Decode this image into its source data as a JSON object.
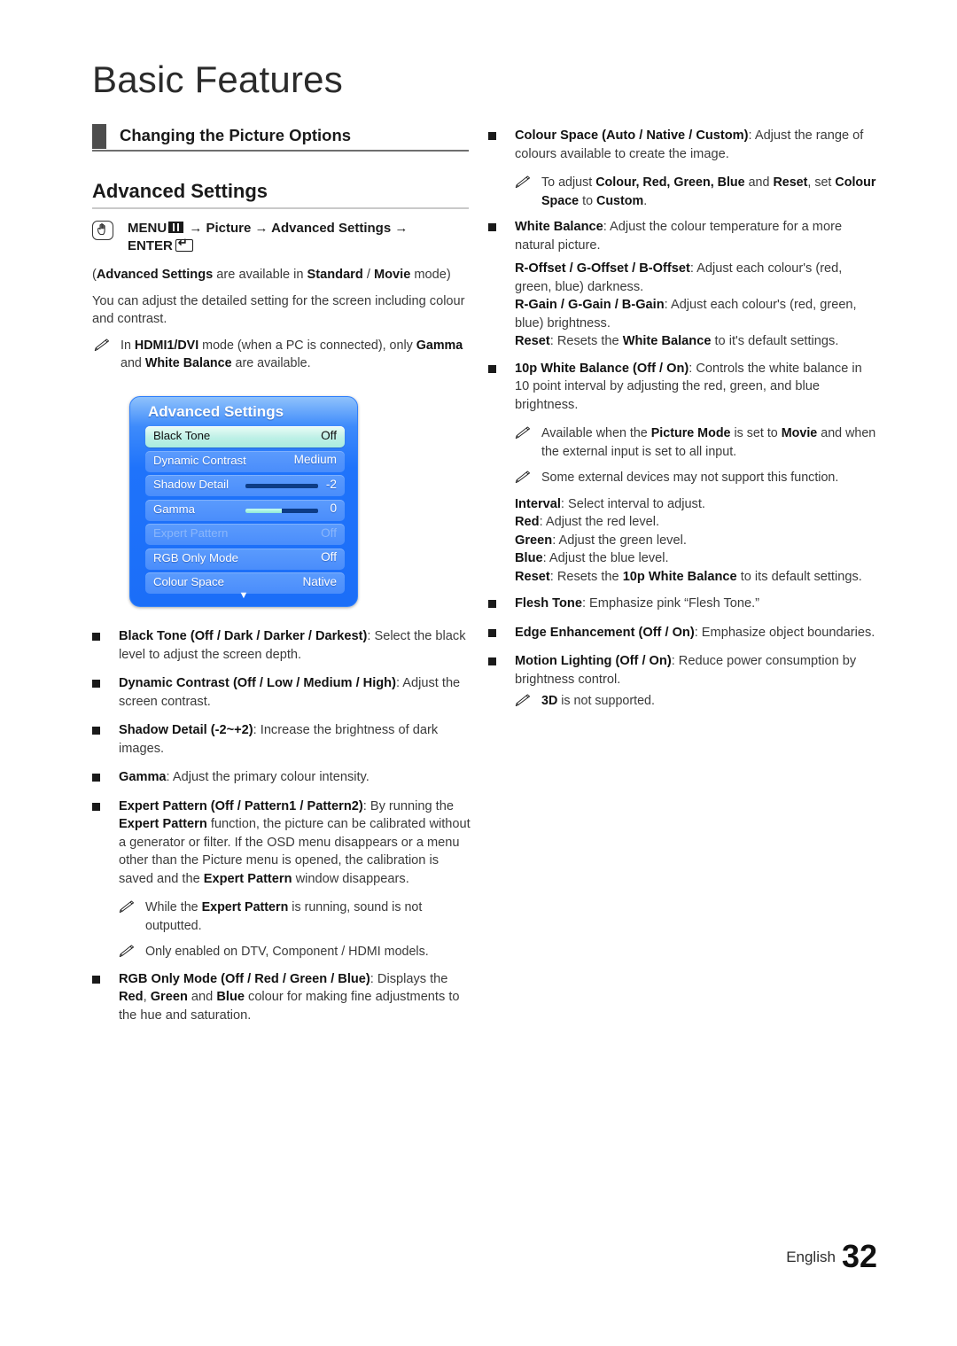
{
  "header": {
    "chapter_title": "Basic Features",
    "section_title": "Changing the Picture Options"
  },
  "topic": {
    "heading": "Advanced Settings",
    "nav_path_part1": "MENU",
    "nav_path_part2": " → Picture → Advanced Settings →",
    "nav_path_part3": "ENTER",
    "availability_note_pre": "(",
    "availability_note": "Advanced Settings are available in Standard / Movie mode)",
    "intro": "You can adjust the detailed setting for the screen including colour and contrast.",
    "hdmi_note": "In HDMI1/DVI mode (when a PC is connected), only Gamma and White Balance are available."
  },
  "osd": {
    "title": "Advanced Settings",
    "scroll_arrow": "▼",
    "rows": [
      {
        "name": "Black Tone",
        "value": "Off",
        "state": "selected",
        "slider": null
      },
      {
        "name": "Dynamic Contrast",
        "value": "Medium",
        "state": "normal",
        "slider": null
      },
      {
        "name": "Shadow Detail",
        "value": "-2",
        "state": "normal",
        "slider": 0
      },
      {
        "name": "Gamma",
        "value": "0",
        "state": "normal",
        "slider": 50
      },
      {
        "name": "Expert Pattern",
        "value": "Off",
        "state": "disabled",
        "slider": null
      },
      {
        "name": "RGB Only Mode",
        "value": "Off",
        "state": "normal",
        "slider": null
      },
      {
        "name": "Colour Space",
        "value": "Native",
        "state": "normal",
        "slider": null
      }
    ]
  },
  "left_column": {
    "bullets": [
      "<b>Black Tone (Off / Dark / Darker / Darkest)</b>: Select the black level to adjust the screen depth.",
      "<b>Dynamic Contrast (Off / Low / Medium / High)</b>: Adjust the screen contrast.",
      "<b>Shadow Detail (-2~+2)</b>: Increase the brightness of dark images.",
      "<b>Gamma</b>: Adjust the primary colour intensity.",
      "<b>Expert Pattern (Off / Pattern1 / Pattern2)</b>: By running the <b>Expert Pattern</b> function, the picture can be calibrated without a generator or filter. If the OSD menu disappears or a menu other than the Picture menu is opened, the calibration is saved and the <b>Expert Pattern</b> window disappears."
    ],
    "expert_notes": [
      "While the <b>Expert Pattern</b> is running, sound is not outputted.",
      "Only enabled on DTV, Component / HDMI models."
    ],
    "rgb_bullet": "<b>RGB Only Mode (Off / Red / Green / Blue)</b>: Displays the <b>Red</b>, <b>Green</b> and <b>Blue</b> colour for making fine adjustments to the hue and saturation."
  },
  "right_column": {
    "colour_space_bullet": "<b>Colour Space (Auto / Native / Custom)</b>: Adjust the range of colours available to create the image.",
    "colour_space_note": "To adjust <b>Colour, Red, Green, Blue</b> and <b>Reset</b>, set <b>Colour Space</b> to <b>Custom</b>.",
    "white_balance_bullet": "<b>White Balance</b>: Adjust the colour temperature for a more natural picture.",
    "white_balance_subs": [
      "<b>R-Offset / G-Offset / B-Offset</b>: Adjust each colour's (red, green, blue) darkness.",
      "<b>R-Gain / G-Gain / B-Gain</b>: Adjust each colour's (red, green, blue) brightness.",
      "<b>Reset</b>: Resets the <b>White Balance</b> to it's default settings."
    ],
    "tenp_bullet": "<b>10p White Balance (Off / On)</b>: Controls the white balance in 10 point interval by adjusting the red, green, and blue brightness.",
    "tenp_notes": [
      "Available when the <b>Picture Mode</b> is set to <b>Movie</b> and when the external input is set to all input.",
      "Some external devices may not support this function."
    ],
    "tenp_subs": [
      "<b>Interval</b>: Select interval to adjust.",
      "<b>Red</b>: Adjust the red level.",
      "<b>Green</b>: Adjust the green level.",
      "<b>Blue</b>: Adjust the blue level.",
      "<b>Reset</b>: Resets the <b>10p White Balance</b> to its default settings."
    ],
    "flesh_tone_bullet": "<b>Flesh Tone</b>: Emphasize pink “Flesh Tone.”",
    "edge_enhancement_bullet": "<b>Edge Enhancement (Off / On)</b>: Emphasize object boundaries.",
    "motion_lighting_bullet": "<b>Motion Lighting (Off / On)</b>: Reduce power consumption by brightness control.",
    "motion_lighting_note": "<b>3D</b> is not supported."
  },
  "footer": {
    "language": "English",
    "page_number": "32"
  }
}
